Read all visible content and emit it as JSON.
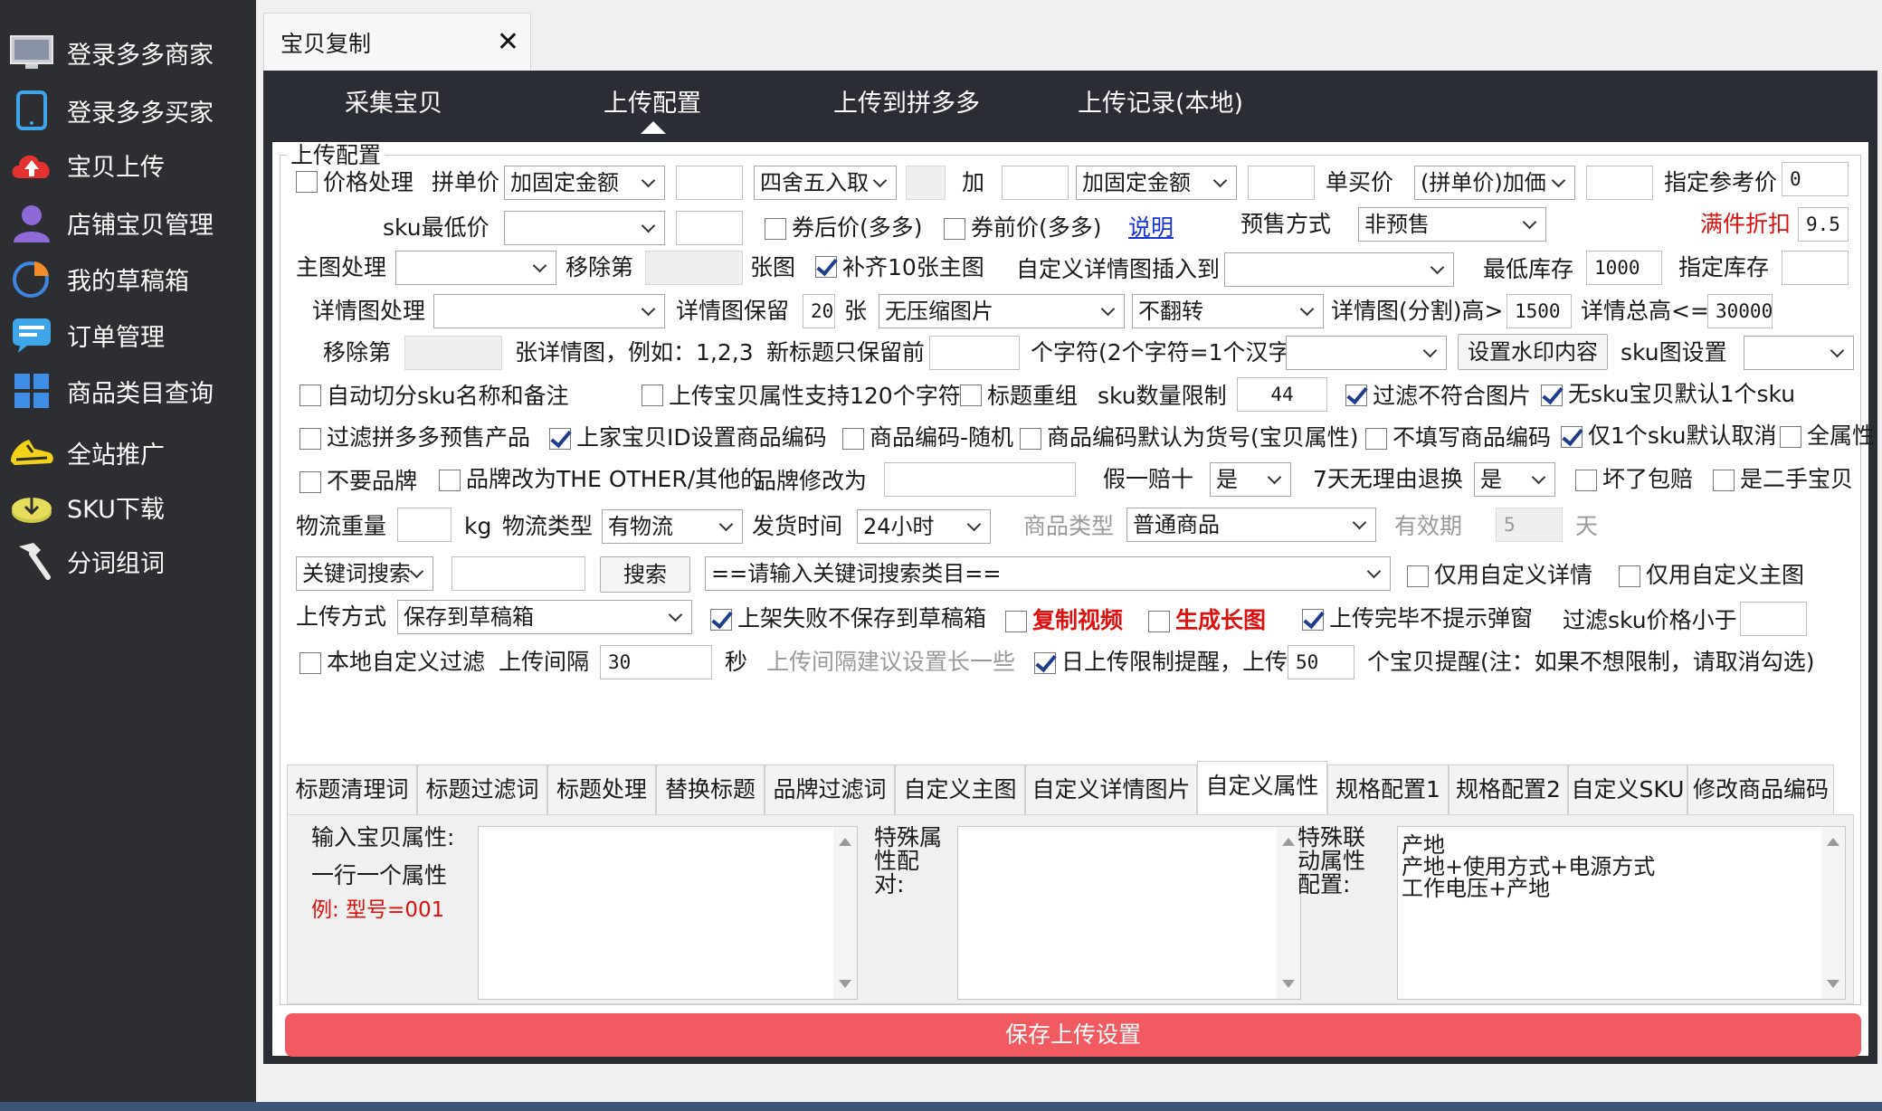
{
  "sidebar": {
    "items": [
      {
        "label": "登录多多商家",
        "icon": "monitor-icon"
      },
      {
        "label": "登录多多买家",
        "icon": "tablet-icon"
      },
      {
        "label": "宝贝上传",
        "icon": "cloud-upload-icon"
      },
      {
        "label": "店铺宝贝管理",
        "icon": "user-icon"
      },
      {
        "label": "我的草稿箱",
        "icon": "pie-chart-icon"
      },
      {
        "label": "订单管理",
        "icon": "chat-bubble-icon"
      },
      {
        "label": "商品类目查询",
        "icon": "grid-icon"
      },
      {
        "label": "全站推广",
        "icon": "sneaker-icon"
      },
      {
        "label": "SKU下载",
        "icon": "download-disk-icon"
      },
      {
        "label": "分词组词",
        "icon": "hammer-icon"
      }
    ]
  },
  "window_tab": {
    "title": "宝贝复制",
    "close": "✕"
  },
  "topnav": {
    "items": [
      "采集宝贝",
      "上传配置",
      "上传到拼多多",
      "上传记录(本地)"
    ],
    "active": 1
  },
  "config": {
    "group_title": "上传配置",
    "row1": {
      "price_label": "价格处理",
      "group_price": "拼单价",
      "sel1": "加固定金额",
      "sel2": "四舍五入取",
      "add": "加",
      "sel3": "加固定金额",
      "single_price": "单买价",
      "sel4": "(拼单价)加価",
      "ref_price": "指定参考价",
      "ref_value": "0"
    },
    "row2": {
      "sku_low": "sku最低价",
      "after_coupon": "券后价(多多)",
      "before_coupon": "券前价(多多)",
      "explain": "说明",
      "presale": "预售方式",
      "presale_value": "非预售",
      "full_discount": "满件折扣",
      "discount_value": "9.5"
    },
    "row3": {
      "main_img": "主图处理",
      "remove_nth": "移除第",
      "sheets": "张图",
      "fill10": "补齐10张主图",
      "custom_detail": "自定义详情图插入到",
      "min_stock": "最低库存",
      "min_stock_value": "1000",
      "set_stock": "指定库存"
    },
    "row4": {
      "detail_proc": "详情图处理",
      "detail_keep": "详情图保留",
      "keep_value": "20",
      "unit": "张",
      "sel_compress": "无压缩图片",
      "sel_flip": "不翻转",
      "split_height": "详情图(分割)高>",
      "split_value": "1500",
      "total_height": "详情总高<=",
      "total_value": "30000"
    },
    "row5": {
      "remove_nth": "移除第",
      "example": "张详情图，例如：1,2,3",
      "new_title": "新标题只保留前",
      "chars": "个字符(2个字符=1个汉字)",
      "watermark_btn": "设置水印内容",
      "sku_img": "sku图设置"
    },
    "row6": {
      "auto_split": "自动切分sku名称和备注",
      "attr120": "上传宝贝属性支持120个字符",
      "title_regroup": "标题重组",
      "sku_limit": "sku数量限制",
      "sku_limit_value": "44",
      "filter_img": "过滤不符合图片",
      "no_sku": "无sku宝贝默认1个sku"
    },
    "row7": {
      "filter_presale": "过滤拼多多预售产品",
      "set_code": "上家宝贝ID设置商品编码",
      "code_random": "商品编码-随机",
      "code_default": "商品编码默认为货号(宝贝属性)",
      "no_code": "不填写商品编码",
      "one_sku_cancel": "仅1个sku默认取消",
      "all_attr": "全属性"
    },
    "row8": {
      "no_brand": "不要品牌",
      "brand_other": "品牌改为THE OTHER/其他的",
      "brand_change": "品牌修改为",
      "fake_ten": "假一赔十",
      "fake_value": "是",
      "seven_days": "7天无理由退换",
      "seven_value": "是",
      "broken": "坏了包赔",
      "second_hand": "是二手宝贝"
    },
    "row9": {
      "weight": "物流重量",
      "kg": "kg",
      "logistics": "物流类型",
      "logistics_value": "有物流",
      "ship_time": "发货时间",
      "ship_value": "24小时",
      "goods_type": "商品类型",
      "goods_value": "普通商品",
      "validity": "有效期",
      "validity_value": "5",
      "day": "天"
    },
    "row10": {
      "keyword_sel": "关键词搜索",
      "search_btn": "搜索",
      "category_placeholder": "==请输入关键词搜索类目==",
      "only_detail": "仅用自定义详情",
      "only_main": "仅用自定义主图"
    },
    "row11": {
      "upload_mode": "上传方式",
      "mode_value": "保存到草稿箱",
      "fail_no_save": "上架失败不保存到草稿箱",
      "copy_video": "复制视频",
      "long_img": "生成长图",
      "no_popup": "上传完毕不提示弹窗",
      "filter_sku_price": "过滤sku价格小于"
    },
    "row12": {
      "local_filter": "本地自定义过滤",
      "interval": "上传间隔",
      "interval_value": "30",
      "sec": "秒",
      "interval_hint": "上传间隔建议设置长一些",
      "daily_limit": "日上传限制提醒，上传",
      "daily_value": "50",
      "reminder": "个宝贝提醒(注：如果不想限制，请取消勾选)"
    }
  },
  "subtabs": {
    "items": [
      "标题清理词",
      "标题过滤词",
      "标题处理",
      "替换标题",
      "品牌过滤词",
      "自定义主图",
      "自定义详情图片",
      "自定义属性",
      "规格配置1",
      "规格配置2",
      "自定义SKU",
      "修改商品编码"
    ],
    "active": 7
  },
  "attr_pane": {
    "input_label": "输入宝贝属性:",
    "one_per_line": "一行一个属性",
    "example": "例: 型号=001",
    "special_pair": "特殊属性配对:",
    "special_link": "特殊联动属性配置:",
    "link_lines": [
      "产地",
      "产地+使用方式+电源方式",
      "工作电压+产地"
    ]
  },
  "save_button": "保存上传设置"
}
